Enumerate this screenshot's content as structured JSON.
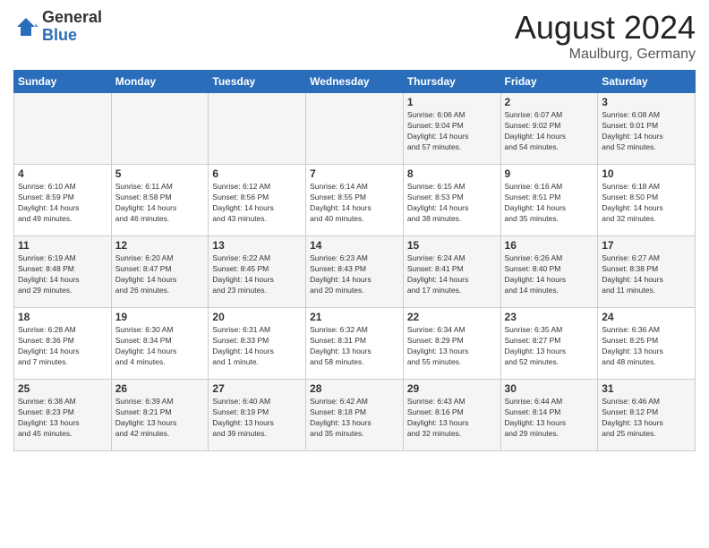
{
  "header": {
    "logo_general": "General",
    "logo_blue": "Blue",
    "month_year": "August 2024",
    "location": "Maulburg, Germany"
  },
  "weekdays": [
    "Sunday",
    "Monday",
    "Tuesday",
    "Wednesday",
    "Thursday",
    "Friday",
    "Saturday"
  ],
  "weeks": [
    [
      {
        "day": "",
        "info": ""
      },
      {
        "day": "",
        "info": ""
      },
      {
        "day": "",
        "info": ""
      },
      {
        "day": "",
        "info": ""
      },
      {
        "day": "1",
        "info": "Sunrise: 6:06 AM\nSunset: 9:04 PM\nDaylight: 14 hours\nand 57 minutes."
      },
      {
        "day": "2",
        "info": "Sunrise: 6:07 AM\nSunset: 9:02 PM\nDaylight: 14 hours\nand 54 minutes."
      },
      {
        "day": "3",
        "info": "Sunrise: 6:08 AM\nSunset: 9:01 PM\nDaylight: 14 hours\nand 52 minutes."
      }
    ],
    [
      {
        "day": "4",
        "info": "Sunrise: 6:10 AM\nSunset: 8:59 PM\nDaylight: 14 hours\nand 49 minutes."
      },
      {
        "day": "5",
        "info": "Sunrise: 6:11 AM\nSunset: 8:58 PM\nDaylight: 14 hours\nand 46 minutes."
      },
      {
        "day": "6",
        "info": "Sunrise: 6:12 AM\nSunset: 8:56 PM\nDaylight: 14 hours\nand 43 minutes."
      },
      {
        "day": "7",
        "info": "Sunrise: 6:14 AM\nSunset: 8:55 PM\nDaylight: 14 hours\nand 40 minutes."
      },
      {
        "day": "8",
        "info": "Sunrise: 6:15 AM\nSunset: 8:53 PM\nDaylight: 14 hours\nand 38 minutes."
      },
      {
        "day": "9",
        "info": "Sunrise: 6:16 AM\nSunset: 8:51 PM\nDaylight: 14 hours\nand 35 minutes."
      },
      {
        "day": "10",
        "info": "Sunrise: 6:18 AM\nSunset: 8:50 PM\nDaylight: 14 hours\nand 32 minutes."
      }
    ],
    [
      {
        "day": "11",
        "info": "Sunrise: 6:19 AM\nSunset: 8:48 PM\nDaylight: 14 hours\nand 29 minutes."
      },
      {
        "day": "12",
        "info": "Sunrise: 6:20 AM\nSunset: 8:47 PM\nDaylight: 14 hours\nand 26 minutes."
      },
      {
        "day": "13",
        "info": "Sunrise: 6:22 AM\nSunset: 8:45 PM\nDaylight: 14 hours\nand 23 minutes."
      },
      {
        "day": "14",
        "info": "Sunrise: 6:23 AM\nSunset: 8:43 PM\nDaylight: 14 hours\nand 20 minutes."
      },
      {
        "day": "15",
        "info": "Sunrise: 6:24 AM\nSunset: 8:41 PM\nDaylight: 14 hours\nand 17 minutes."
      },
      {
        "day": "16",
        "info": "Sunrise: 6:26 AM\nSunset: 8:40 PM\nDaylight: 14 hours\nand 14 minutes."
      },
      {
        "day": "17",
        "info": "Sunrise: 6:27 AM\nSunset: 8:38 PM\nDaylight: 14 hours\nand 11 minutes."
      }
    ],
    [
      {
        "day": "18",
        "info": "Sunrise: 6:28 AM\nSunset: 8:36 PM\nDaylight: 14 hours\nand 7 minutes."
      },
      {
        "day": "19",
        "info": "Sunrise: 6:30 AM\nSunset: 8:34 PM\nDaylight: 14 hours\nand 4 minutes."
      },
      {
        "day": "20",
        "info": "Sunrise: 6:31 AM\nSunset: 8:33 PM\nDaylight: 14 hours\nand 1 minute."
      },
      {
        "day": "21",
        "info": "Sunrise: 6:32 AM\nSunset: 8:31 PM\nDaylight: 13 hours\nand 58 minutes."
      },
      {
        "day": "22",
        "info": "Sunrise: 6:34 AM\nSunset: 8:29 PM\nDaylight: 13 hours\nand 55 minutes."
      },
      {
        "day": "23",
        "info": "Sunrise: 6:35 AM\nSunset: 8:27 PM\nDaylight: 13 hours\nand 52 minutes."
      },
      {
        "day": "24",
        "info": "Sunrise: 6:36 AM\nSunset: 8:25 PM\nDaylight: 13 hours\nand 48 minutes."
      }
    ],
    [
      {
        "day": "25",
        "info": "Sunrise: 6:38 AM\nSunset: 8:23 PM\nDaylight: 13 hours\nand 45 minutes."
      },
      {
        "day": "26",
        "info": "Sunrise: 6:39 AM\nSunset: 8:21 PM\nDaylight: 13 hours\nand 42 minutes."
      },
      {
        "day": "27",
        "info": "Sunrise: 6:40 AM\nSunset: 8:19 PM\nDaylight: 13 hours\nand 39 minutes."
      },
      {
        "day": "28",
        "info": "Sunrise: 6:42 AM\nSunset: 8:18 PM\nDaylight: 13 hours\nand 35 minutes."
      },
      {
        "day": "29",
        "info": "Sunrise: 6:43 AM\nSunset: 8:16 PM\nDaylight: 13 hours\nand 32 minutes."
      },
      {
        "day": "30",
        "info": "Sunrise: 6:44 AM\nSunset: 8:14 PM\nDaylight: 13 hours\nand 29 minutes."
      },
      {
        "day": "31",
        "info": "Sunrise: 6:46 AM\nSunset: 8:12 PM\nDaylight: 13 hours\nand 25 minutes."
      }
    ]
  ]
}
